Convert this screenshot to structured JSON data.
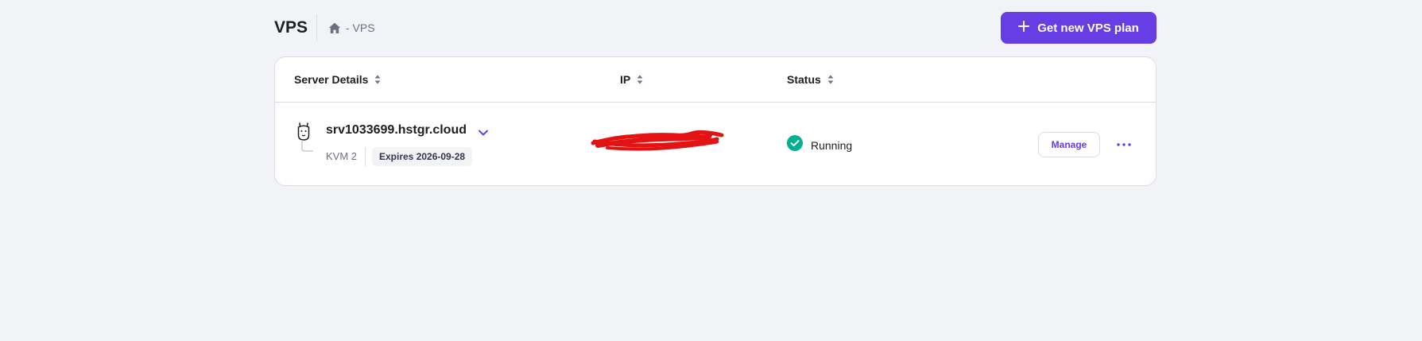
{
  "header": {
    "title": "VPS",
    "breadcrumb_icon": "home-icon",
    "breadcrumb_text": "- VPS",
    "new_plan_button": "Get new VPS plan",
    "new_plan_icon": "plus-icon"
  },
  "colors": {
    "accent": "#673de6",
    "background": "#f2f3f6",
    "status_running": "#00b090",
    "redaction": "#e41313"
  },
  "table": {
    "columns": [
      {
        "label": "Server Details",
        "sort_icon": "sort-icon"
      },
      {
        "label": "IP",
        "sort_icon": "sort-icon"
      },
      {
        "label": "Status",
        "sort_icon": "sort-icon"
      }
    ],
    "rows": [
      {
        "hostname": "srv1033699.hstgr.cloud",
        "avatar_icon": "llama-icon",
        "plan": "KVM 2",
        "expires": "Expires 2026-09-28",
        "ip": "",
        "ip_redacted": true,
        "status": "Running",
        "status_icon": "check-circle-icon",
        "manage_label": "Manage",
        "more_icon": "more-horizontal-icon"
      }
    ]
  }
}
